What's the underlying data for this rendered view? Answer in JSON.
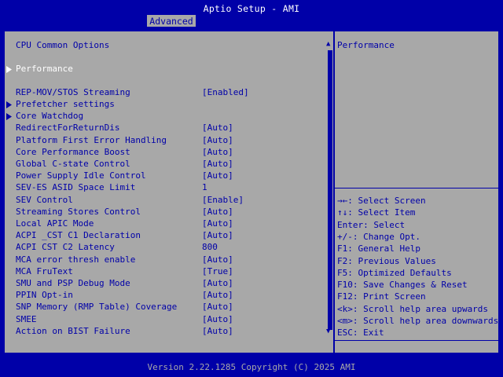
{
  "header": {
    "title": "Aptio Setup - AMI",
    "active_tab": "Advanced"
  },
  "page": {
    "section_title": "CPU Common Options"
  },
  "items": [
    {
      "label": "Performance",
      "value": "",
      "submenu": true,
      "selected": true
    },
    {
      "label": "REP-MOV/STOS Streaming",
      "value": "[Enabled]",
      "submenu": false
    },
    {
      "label": "Prefetcher settings",
      "value": "",
      "submenu": true
    },
    {
      "label": "Core Watchdog",
      "value": "",
      "submenu": true
    },
    {
      "label": "RedirectForReturnDis",
      "value": "[Auto]",
      "submenu": false
    },
    {
      "label": "Platform First Error Handling",
      "value": "[Auto]",
      "submenu": false
    },
    {
      "label": "Core Performance Boost",
      "value": "[Auto]",
      "submenu": false
    },
    {
      "label": "Global C-state Control",
      "value": "[Auto]",
      "submenu": false
    },
    {
      "label": "Power Supply Idle Control",
      "value": "[Auto]",
      "submenu": false
    },
    {
      "label": "SEV-ES ASID Space Limit",
      "value": "1",
      "submenu": false
    },
    {
      "label": "SEV Control",
      "value": "[Enable]",
      "submenu": false
    },
    {
      "label": "Streaming Stores Control",
      "value": "[Auto]",
      "submenu": false
    },
    {
      "label": "Local APIC Mode",
      "value": "[Auto]",
      "submenu": false
    },
    {
      "label": "ACPI _CST C1 Declaration",
      "value": "[Auto]",
      "submenu": false
    },
    {
      "label": "ACPI CST C2 Latency",
      "value": "800",
      "submenu": false
    },
    {
      "label": "MCA error thresh enable",
      "value": "[Auto]",
      "submenu": false
    },
    {
      "label": "MCA FruText",
      "value": "[True]",
      "submenu": false
    },
    {
      "label": "SMU and PSP Debug Mode",
      "value": "[Auto]",
      "submenu": false
    },
    {
      "label": "PPIN Opt-in",
      "value": "[Auto]",
      "submenu": false
    },
    {
      "label": "SNP Memory (RMP Table) Coverage",
      "value": "[Auto]",
      "submenu": false
    },
    {
      "label": "SMEE",
      "value": "[Auto]",
      "submenu": false
    },
    {
      "label": "Action on BIST Failure",
      "value": "[Auto]",
      "submenu": false
    }
  ],
  "help": {
    "description": "Performance",
    "keys": [
      "→←: Select Screen",
      "↑↓: Select Item",
      "Enter: Select",
      "+/-: Change Opt.",
      "F1: General Help",
      "F2: Previous Values",
      "F5: Optimized Defaults",
      "F10: Save Changes & Reset",
      "F12: Print Screen",
      "<k>: Scroll help area upwards",
      "<m>: Scroll help area downwards",
      "ESC: Exit"
    ]
  },
  "footer": {
    "text": "Version 2.22.1285 Copyright (C) 2025 AMI"
  },
  "colors": {
    "background": "#0000a8",
    "panel": "#a8a8a8",
    "highlight_text": "#ffffff"
  }
}
